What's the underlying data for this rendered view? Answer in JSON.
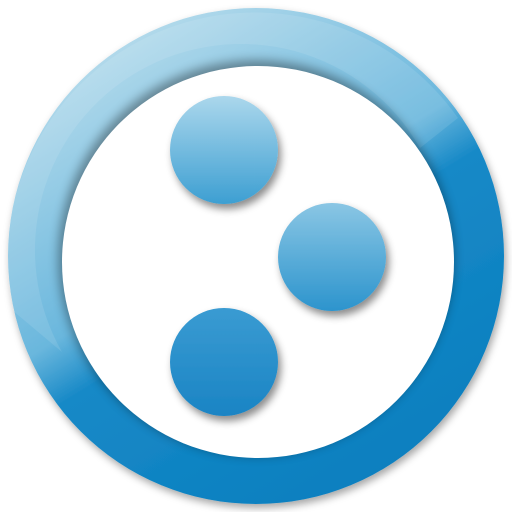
{
  "icon": {
    "name": "three-dots-in-ring-logo",
    "colors": {
      "ring_light": "#a9d6ea",
      "ring_mid": "#5fb2da",
      "ring_dark": "#0a82c2",
      "dot_light": "#a4d3ea",
      "dot_dark": "#1a86c6",
      "interior": "#ffffff"
    }
  }
}
